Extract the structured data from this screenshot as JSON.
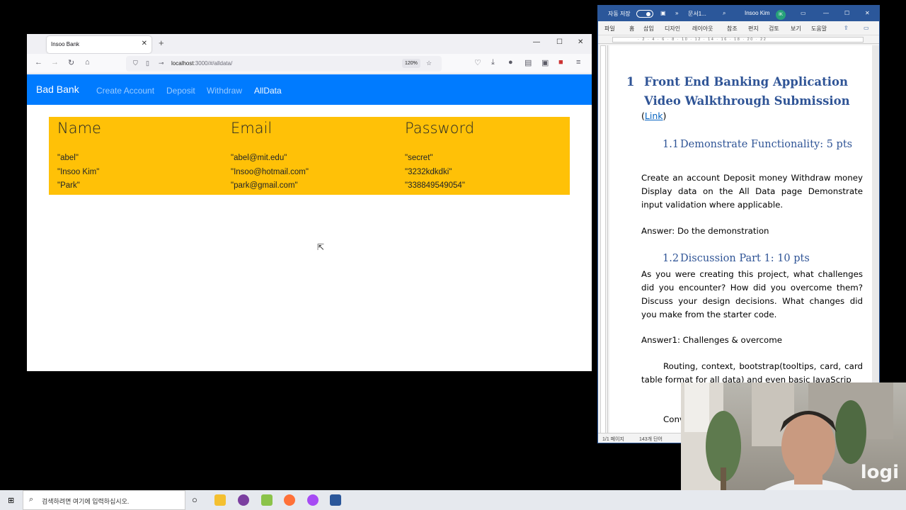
{
  "browser": {
    "tab_title": "Insoo Bank",
    "new_tab": "+",
    "url_host": "localhost",
    "url_rest": ":3000/#/alldata/",
    "zoom": "120%"
  },
  "app": {
    "brand": "Bad Bank",
    "nav": [
      "Create Account",
      "Deposit",
      "Withdraw",
      "AllData"
    ],
    "active_nav": "AllData",
    "accent_color": "#007bff",
    "card_color": "#ffc107"
  },
  "alldata": {
    "headers": [
      "Name",
      "Email",
      "Password"
    ],
    "rows": [
      [
        "\"abel\"",
        "\"abel@mit.edu\"",
        "\"secret\""
      ],
      [
        "\"Insoo Kim\"",
        "\"Insoo@hotmail.com\"",
        "\"3232kdkdki\""
      ],
      [
        "\"Park\"",
        "\"park@gmail.com\"",
        "\"338849549054\""
      ]
    ]
  },
  "word": {
    "autosave": "자동 저장",
    "doc_name": "문서1...",
    "user": "Insoo Kim",
    "user_initials": "IK",
    "menu": [
      "파일",
      "홈",
      "삽입",
      "디자인",
      "레이아웃",
      "참조",
      "편지",
      "검토",
      "보기",
      "도움말"
    ],
    "heading1_num": "1",
    "heading1": "Front End Banking Application Video Walkthrough Submission",
    "link_open": "(",
    "link_text": "Link",
    "link_close": ")",
    "h2a_num": "1.1",
    "h2a": "Demonstrate Functionality: 5 pts",
    "p1": "Create an account Deposit money Withdraw money Display data on the All Data page Demonstrate input validation where applicable.",
    "p2": "Answer: Do the demonstration",
    "h2b_num": "1.2",
    "h2b": "Discussion Part 1: 10 pts",
    "p3": "As you were creating this project, what challenges did you encounter? How did you overcome them? Discuss your design decisions. What changes did you make from the starter code.",
    "p4": "Answer1: Challenges & overcome",
    "p5": "Routing, context, bootstrap(tooltips, card, card table format for all data) and even basic JavaScrip",
    "p6": "Conv",
    "status_page": "1/1 페이지",
    "status_words": "143개 단어"
  },
  "webcam": {
    "logo": "logi"
  },
  "taskbar": {
    "search_placeholder": "검색하려면 여기에 입력하십시오."
  }
}
